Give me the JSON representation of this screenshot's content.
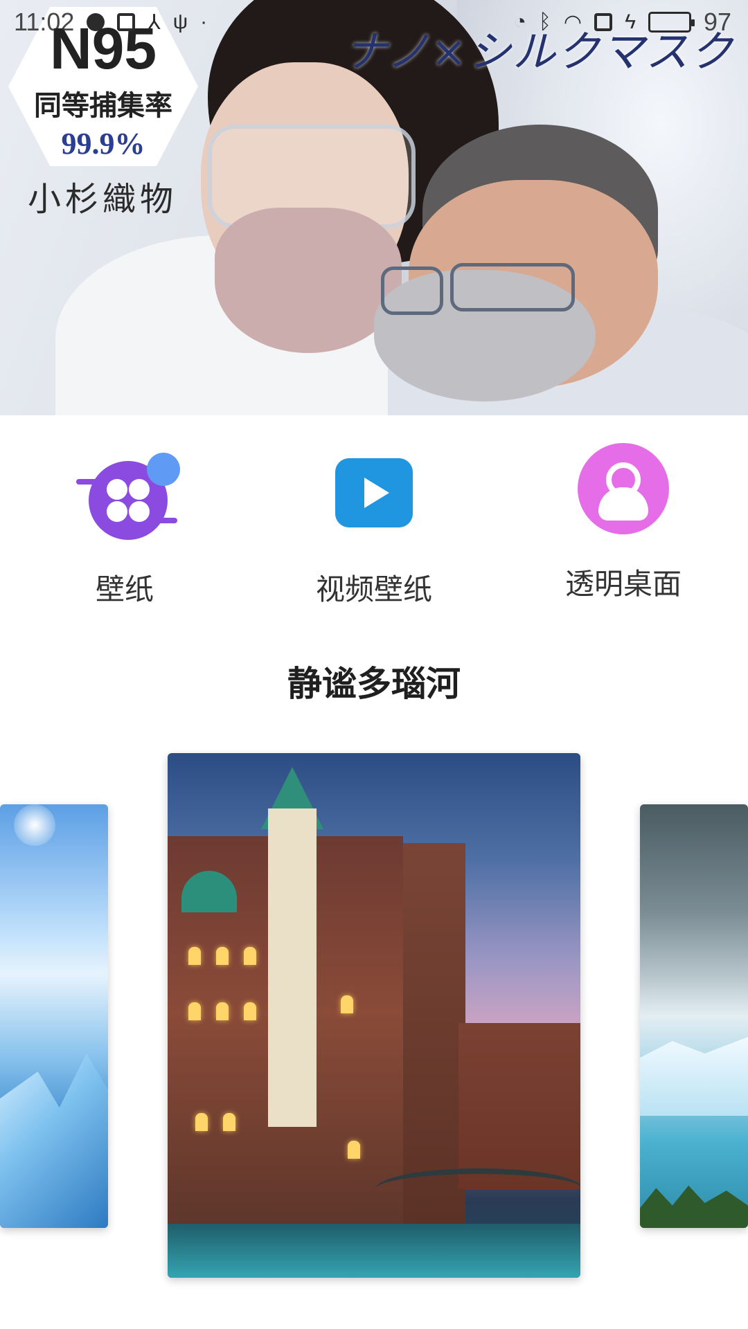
{
  "status_bar": {
    "time": "11:02",
    "battery": "97",
    "battery_fill": 0.97,
    "colors": {
      "battery": "#2ec24a"
    }
  },
  "banner": {
    "badge_title": "N95",
    "badge_sub": "同等捕集率",
    "badge_rate": "99.9%",
    "brand": "小杉織物",
    "jp_text": "ナノ×シルクマスク"
  },
  "features": [
    {
      "label": "壁纸",
      "icon": "clover-wallpaper-icon",
      "color": "#8b4be0"
    },
    {
      "label": "视频壁纸",
      "icon": "play-video-icon",
      "color": "#1f96df"
    },
    {
      "label": "透明桌面",
      "icon": "person-transparent-icon",
      "color": "#e66de8"
    }
  ],
  "section": {
    "title": "静谧多瑙河"
  },
  "carousel": {
    "cards": [
      {
        "icon": "glacier-sky-wallpaper"
      },
      {
        "icon": "city-canal-wallpaper"
      },
      {
        "icon": "glacier-lake-wallpaper"
      }
    ]
  }
}
